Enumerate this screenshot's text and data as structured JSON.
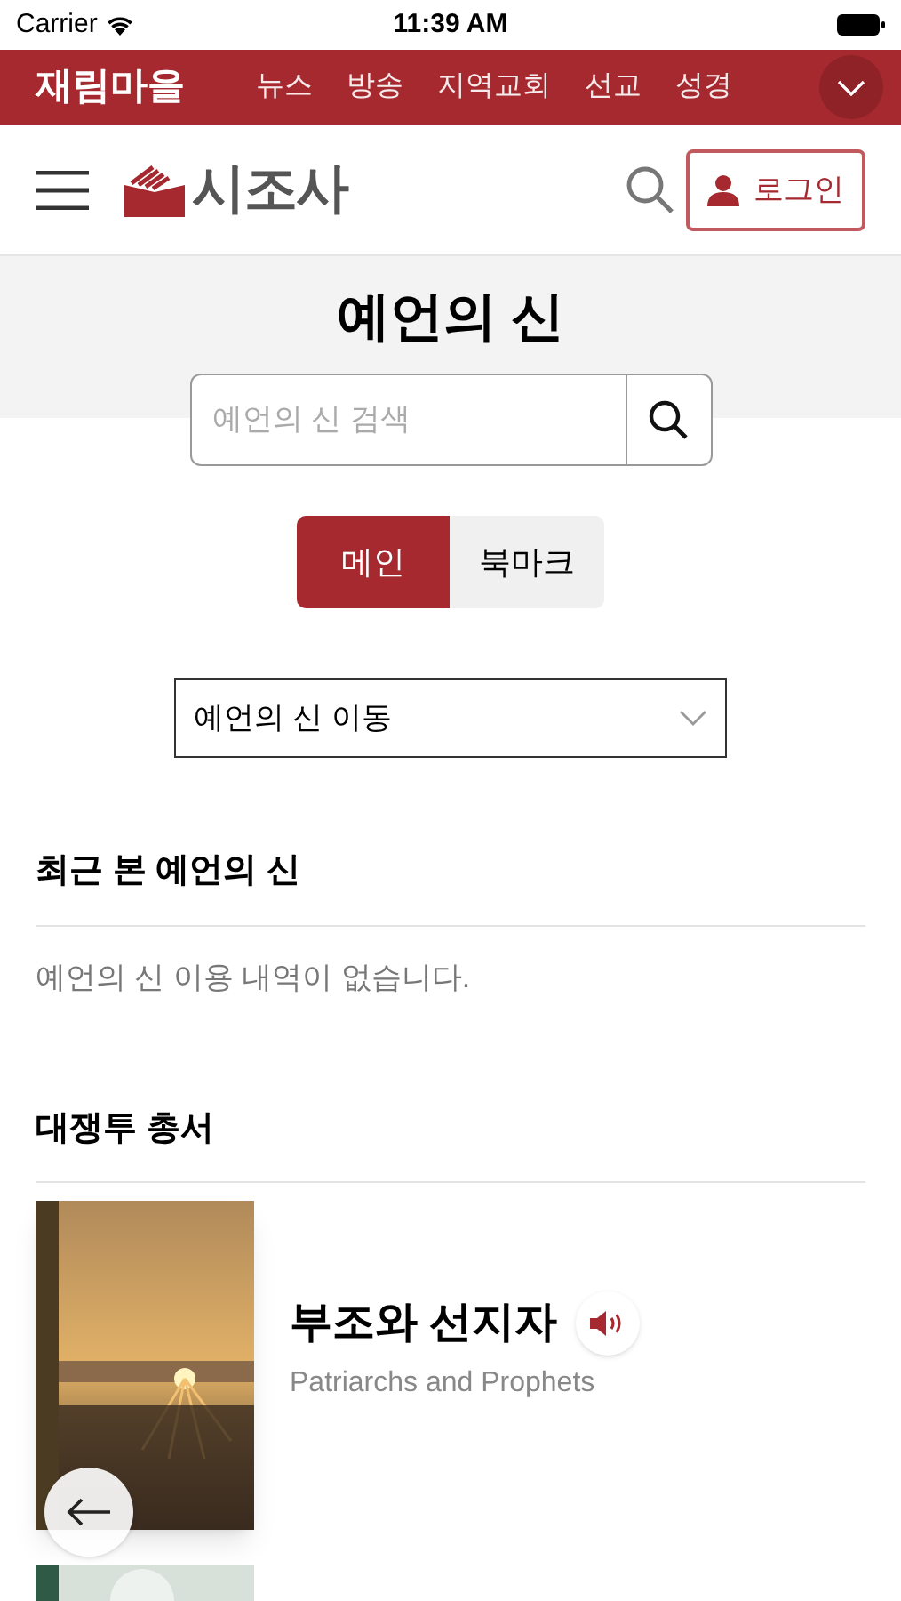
{
  "status_bar": {
    "carrier": "Carrier",
    "time": "11:39 AM"
  },
  "top_nav": {
    "brand": "재림마을",
    "items": [
      {
        "label": "뉴스"
      },
      {
        "label": "방송"
      },
      {
        "label": "지역교회"
      },
      {
        "label": "선교"
      },
      {
        "label": "성경"
      }
    ]
  },
  "header": {
    "logo": "시조사",
    "login": "로그인"
  },
  "page": {
    "title": "예언의 신",
    "search": {
      "placeholder": "예언의 신 검색"
    },
    "tabs": [
      {
        "label": "메인",
        "selected": true
      },
      {
        "label": "북마크",
        "selected": false
      }
    ],
    "dropdown": {
      "value": "예언의 신 이동"
    }
  },
  "recent": {
    "heading": "최근 본 예언의 신",
    "empty": "예언의 신 이용 내역이 없습니다."
  },
  "series": {
    "heading": "대쟁투 총서",
    "books": [
      {
        "title": "부조와 선지자",
        "subtitle": "Patriarchs and Prophets"
      }
    ]
  }
}
